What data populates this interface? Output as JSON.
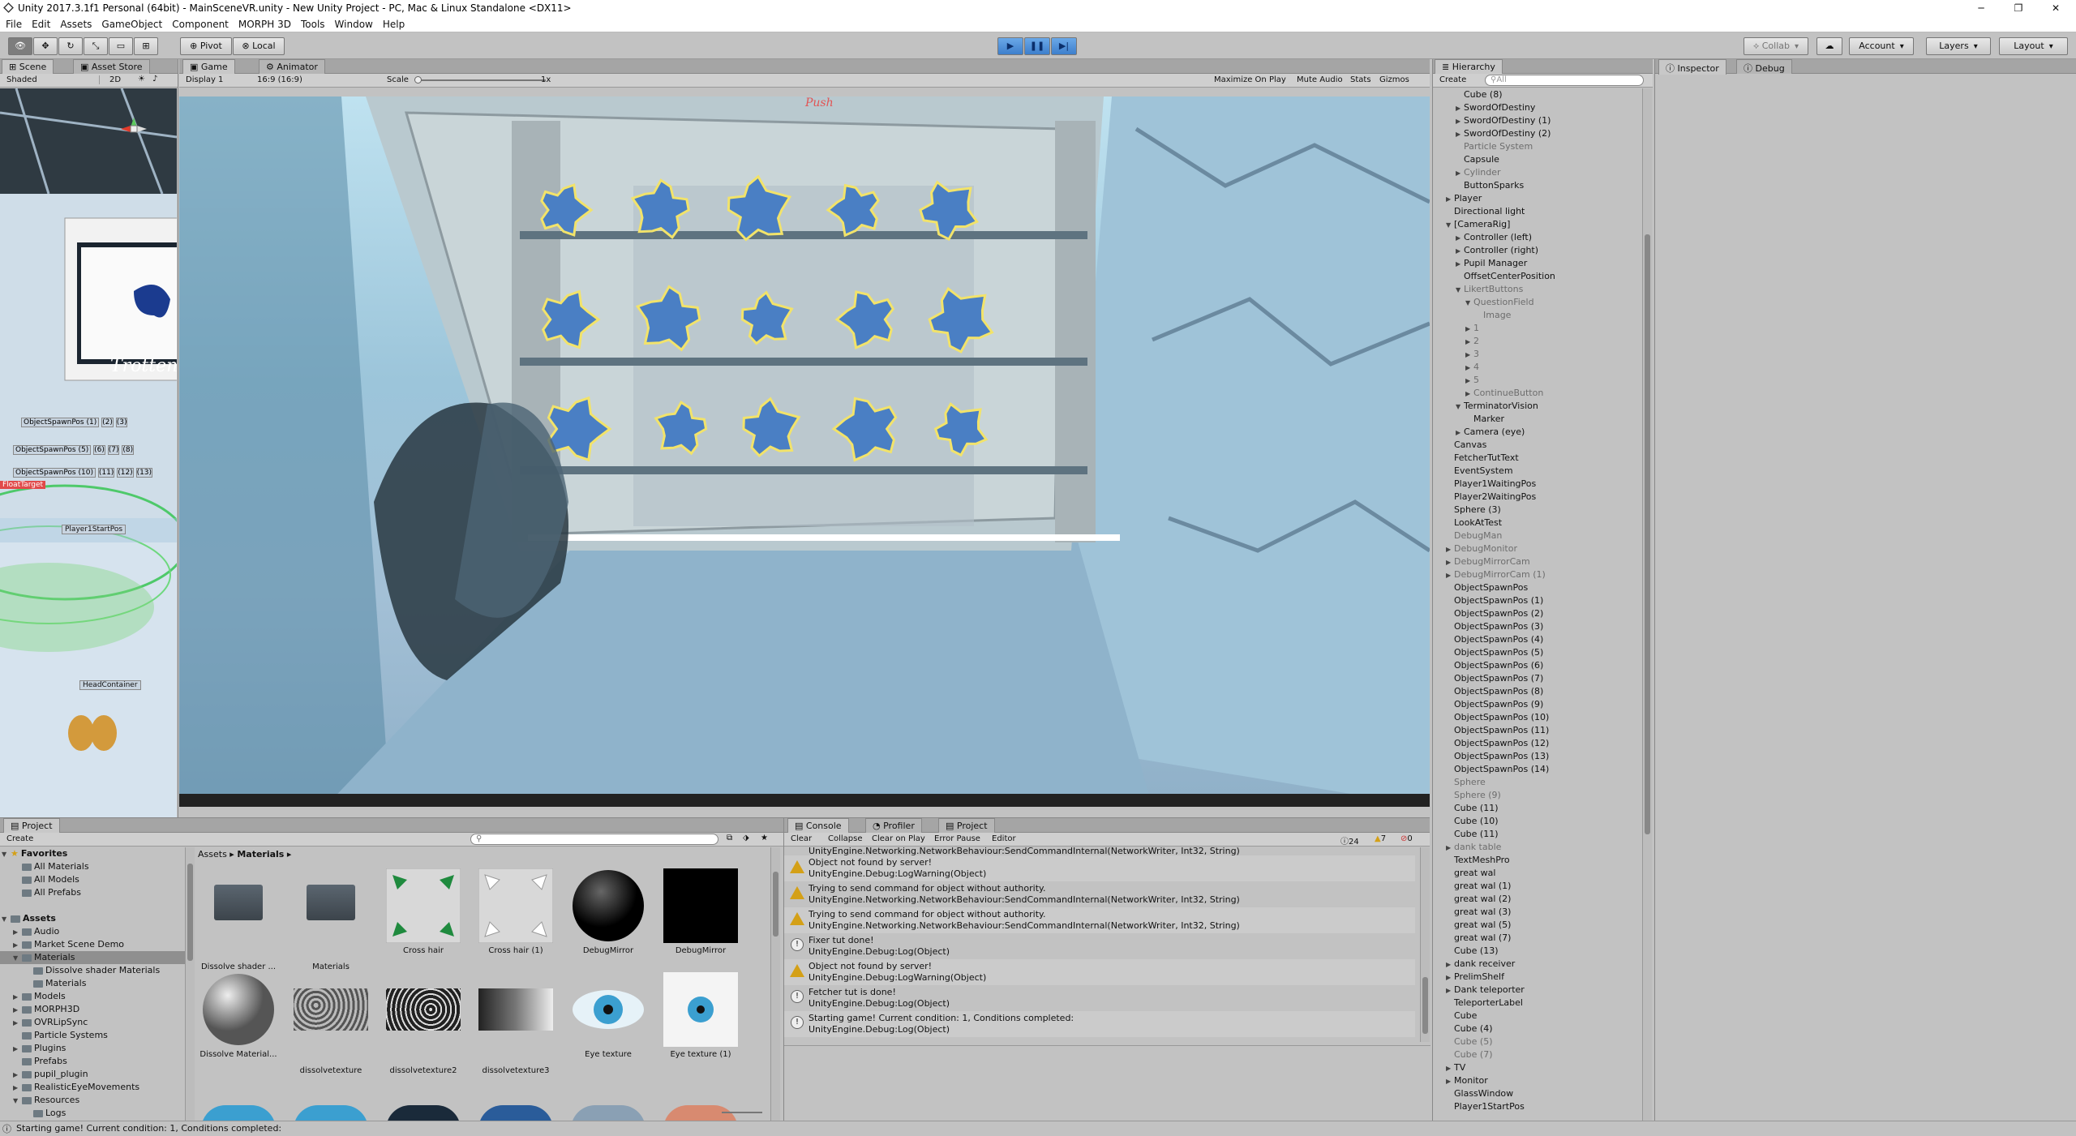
{
  "window": {
    "title": "Unity 2017.3.1f1 Personal (64bit) - MainSceneVR.unity - New Unity Project - PC, Mac & Linux Standalone <DX11>"
  },
  "menu": [
    "File",
    "Edit",
    "Assets",
    "GameObject",
    "Component",
    "MORPH 3D",
    "Tools",
    "Window",
    "Help"
  ],
  "toolbar": {
    "pivot": "Pivot",
    "local": "Local",
    "collab": "Collab",
    "account": "Account",
    "layers": "Layers",
    "layout": "Layout"
  },
  "scene": {
    "tabs": [
      "Scene",
      "Asset Store"
    ],
    "shading": "Shaded",
    "mode2d": "2D",
    "labels": [
      "ObjectSpawnPos (1)",
      "(2)",
      "(3)",
      "ObjectSpawnPos (5)",
      "(6)",
      "(7)",
      "(8)",
      "ObjectSpawnPos (10)",
      "(11)",
      "(12)",
      "(13)",
      "FloatTarget",
      "Player1StartPos",
      "HeadContainer"
    ],
    "monitor_text": "Trotten"
  },
  "game": {
    "tabs": [
      "Game",
      "Animator"
    ],
    "display": "Display 1",
    "aspect": "16:9 (16:9)",
    "scale_label": "Scale",
    "scale_value": "1x",
    "options": [
      "Maximize On Play",
      "Mute Audio",
      "Stats",
      "Gizmos"
    ],
    "annotation": "Push"
  },
  "hierarchy": {
    "tab": "Hierarchy",
    "create": "Create",
    "search": "All",
    "items": [
      {
        "label": "Cube (8)",
        "indent": 2,
        "arrow": "",
        "dim": false
      },
      {
        "label": "SwordOfDestiny",
        "indent": 2,
        "arrow": "r",
        "dim": false
      },
      {
        "label": "SwordOfDestiny (1)",
        "indent": 2,
        "arrow": "r",
        "dim": false
      },
      {
        "label": "SwordOfDestiny (2)",
        "indent": 2,
        "arrow": "r",
        "dim": false
      },
      {
        "label": "Particle System",
        "indent": 2,
        "arrow": "",
        "dim": true
      },
      {
        "label": "Capsule",
        "indent": 2,
        "arrow": "",
        "dim": false
      },
      {
        "label": "Cylinder",
        "indent": 2,
        "arrow": "r",
        "dim": true
      },
      {
        "label": "ButtonSparks",
        "indent": 2,
        "arrow": "",
        "dim": false
      },
      {
        "label": "Player",
        "indent": 1,
        "arrow": "r",
        "dim": false
      },
      {
        "label": "Directional light",
        "indent": 1,
        "arrow": "",
        "dim": false
      },
      {
        "label": "[CameraRig]",
        "indent": 1,
        "arrow": "d",
        "dim": false
      },
      {
        "label": "Controller (left)",
        "indent": 2,
        "arrow": "r",
        "dim": false
      },
      {
        "label": "Controller (right)",
        "indent": 2,
        "arrow": "r",
        "dim": false
      },
      {
        "label": "Pupil Manager",
        "indent": 2,
        "arrow": "r",
        "dim": false
      },
      {
        "label": "OffsetCenterPosition",
        "indent": 2,
        "arrow": "",
        "dim": false
      },
      {
        "label": "LikertButtons",
        "indent": 2,
        "arrow": "d",
        "dim": true
      },
      {
        "label": "QuestionField",
        "indent": 3,
        "arrow": "d",
        "dim": true
      },
      {
        "label": "Image",
        "indent": 4,
        "arrow": "",
        "dim": true
      },
      {
        "label": "1",
        "indent": 3,
        "arrow": "r",
        "dim": true
      },
      {
        "label": "2",
        "indent": 3,
        "arrow": "r",
        "dim": true
      },
      {
        "label": "3",
        "indent": 3,
        "arrow": "r",
        "dim": true
      },
      {
        "label": "4",
        "indent": 3,
        "arrow": "r",
        "dim": true
      },
      {
        "label": "5",
        "indent": 3,
        "arrow": "r",
        "dim": true
      },
      {
        "label": "ContinueButton",
        "indent": 3,
        "arrow": "r",
        "dim": true
      },
      {
        "label": "TerminatorVision",
        "indent": 2,
        "arrow": "d",
        "dim": false
      },
      {
        "label": "Marker",
        "indent": 3,
        "arrow": "",
        "dim": false
      },
      {
        "label": "Camera (eye)",
        "indent": 2,
        "arrow": "r",
        "dim": false
      },
      {
        "label": "Canvas",
        "indent": 1,
        "arrow": "",
        "dim": false
      },
      {
        "label": "FetcherTutText",
        "indent": 1,
        "arrow": "",
        "dim": false
      },
      {
        "label": "EventSystem",
        "indent": 1,
        "arrow": "",
        "dim": false
      },
      {
        "label": "Player1WaitingPos",
        "indent": 1,
        "arrow": "",
        "dim": false
      },
      {
        "label": "Player2WaitingPos",
        "indent": 1,
        "arrow": "",
        "dim": false
      },
      {
        "label": "Sphere (3)",
        "indent": 1,
        "arrow": "",
        "dim": false
      },
      {
        "label": "LookAtTest",
        "indent": 1,
        "arrow": "",
        "dim": false
      },
      {
        "label": "DebugMan",
        "indent": 1,
        "arrow": "",
        "dim": true
      },
      {
        "label": "DebugMonitor",
        "indent": 1,
        "arrow": "r",
        "dim": true
      },
      {
        "label": "DebugMirrorCam",
        "indent": 1,
        "arrow": "r",
        "dim": true
      },
      {
        "label": "DebugMirrorCam (1)",
        "indent": 1,
        "arrow": "r",
        "dim": true
      },
      {
        "label": "ObjectSpawnPos",
        "indent": 1,
        "arrow": "",
        "dim": false
      },
      {
        "label": "ObjectSpawnPos (1)",
        "indent": 1,
        "arrow": "",
        "dim": false
      },
      {
        "label": "ObjectSpawnPos (2)",
        "indent": 1,
        "arrow": "",
        "dim": false
      },
      {
        "label": "ObjectSpawnPos (3)",
        "indent": 1,
        "arrow": "",
        "dim": false
      },
      {
        "label": "ObjectSpawnPos (4)",
        "indent": 1,
        "arrow": "",
        "dim": false
      },
      {
        "label": "ObjectSpawnPos (5)",
        "indent": 1,
        "arrow": "",
        "dim": false
      },
      {
        "label": "ObjectSpawnPos (6)",
        "indent": 1,
        "arrow": "",
        "dim": false
      },
      {
        "label": "ObjectSpawnPos (7)",
        "indent": 1,
        "arrow": "",
        "dim": false
      },
      {
        "label": "ObjectSpawnPos (8)",
        "indent": 1,
        "arrow": "",
        "dim": false
      },
      {
        "label": "ObjectSpawnPos (9)",
        "indent": 1,
        "arrow": "",
        "dim": false
      },
      {
        "label": "ObjectSpawnPos (10)",
        "indent": 1,
        "arrow": "",
        "dim": false
      },
      {
        "label": "ObjectSpawnPos (11)",
        "indent": 1,
        "arrow": "",
        "dim": false
      },
      {
        "label": "ObjectSpawnPos (12)",
        "indent": 1,
        "arrow": "",
        "dim": false
      },
      {
        "label": "ObjectSpawnPos (13)",
        "indent": 1,
        "arrow": "",
        "dim": false
      },
      {
        "label": "ObjectSpawnPos (14)",
        "indent": 1,
        "arrow": "",
        "dim": false
      },
      {
        "label": "Sphere",
        "indent": 1,
        "arrow": "",
        "dim": true
      },
      {
        "label": "Sphere (9)",
        "indent": 1,
        "arrow": "",
        "dim": true
      },
      {
        "label": "Cube (11)",
        "indent": 1,
        "arrow": "",
        "dim": false
      },
      {
        "label": "Cube (10)",
        "indent": 1,
        "arrow": "",
        "dim": false
      },
      {
        "label": "Cube (11)",
        "indent": 1,
        "arrow": "",
        "dim": false
      },
      {
        "label": "dank table",
        "indent": 1,
        "arrow": "r",
        "dim": true
      },
      {
        "label": "TextMeshPro",
        "indent": 1,
        "arrow": "",
        "dim": false
      },
      {
        "label": "great wal",
        "indent": 1,
        "arrow": "",
        "dim": false
      },
      {
        "label": "great wal (1)",
        "indent": 1,
        "arrow": "",
        "dim": false
      },
      {
        "label": "great wal (2)",
        "indent": 1,
        "arrow": "",
        "dim": false
      },
      {
        "label": "great wal (3)",
        "indent": 1,
        "arrow": "",
        "dim": false
      },
      {
        "label": "great wal (5)",
        "indent": 1,
        "arrow": "",
        "dim": false
      },
      {
        "label": "great wal (7)",
        "indent": 1,
        "arrow": "",
        "dim": false
      },
      {
        "label": "Cube (13)",
        "indent": 1,
        "arrow": "",
        "dim": false
      },
      {
        "label": "dank receiver",
        "indent": 1,
        "arrow": "r",
        "dim": false
      },
      {
        "label": "PrelimShelf",
        "indent": 1,
        "arrow": "r",
        "dim": false
      },
      {
        "label": "Dank teleporter",
        "indent": 1,
        "arrow": "r",
        "dim": false
      },
      {
        "label": "TeleporterLabel",
        "indent": 1,
        "arrow": "",
        "dim": false
      },
      {
        "label": "Cube",
        "indent": 1,
        "arrow": "",
        "dim": false
      },
      {
        "label": "Cube (4)",
        "indent": 1,
        "arrow": "",
        "dim": false
      },
      {
        "label": "Cube (5)",
        "indent": 1,
        "arrow": "",
        "dim": true
      },
      {
        "label": "Cube (7)",
        "indent": 1,
        "arrow": "",
        "dim": true
      },
      {
        "label": "TV",
        "indent": 1,
        "arrow": "r",
        "dim": false
      },
      {
        "label": "Monitor",
        "indent": 1,
        "arrow": "r",
        "dim": false
      },
      {
        "label": "GlassWindow",
        "indent": 1,
        "arrow": "",
        "dim": false
      },
      {
        "label": "Player1StartPos",
        "indent": 1,
        "arrow": "",
        "dim": false
      }
    ]
  },
  "inspector": {
    "tabs": [
      "Inspector",
      "Debug"
    ]
  },
  "project": {
    "tab": "Project",
    "create": "Create",
    "breadcrumb": [
      "Assets",
      "Materials"
    ],
    "tree": [
      {
        "label": "Favorites",
        "indent": 0,
        "bold": true,
        "arrow": "d"
      },
      {
        "label": "All Materials",
        "indent": 1,
        "bold": false,
        "arrow": ""
      },
      {
        "label": "All Models",
        "indent": 1,
        "bold": false,
        "arrow": ""
      },
      {
        "label": "All Prefabs",
        "indent": 1,
        "bold": false,
        "arrow": ""
      },
      {
        "label": "",
        "indent": 0,
        "bold": false,
        "arrow": ""
      },
      {
        "label": "Assets",
        "indent": 0,
        "bold": true,
        "arrow": "d"
      },
      {
        "label": "Audio",
        "indent": 1,
        "bold": false,
        "arrow": "r"
      },
      {
        "label": "Market Scene Demo",
        "indent": 1,
        "bold": false,
        "arrow": "r"
      },
      {
        "label": "Materials",
        "indent": 1,
        "bold": false,
        "arrow": "d",
        "sel": true
      },
      {
        "label": "Dissolve shader Materials",
        "indent": 2,
        "bold": false,
        "arrow": ""
      },
      {
        "label": "Materials",
        "indent": 2,
        "bold": false,
        "arrow": ""
      },
      {
        "label": "Models",
        "indent": 1,
        "bold": false,
        "arrow": "r"
      },
      {
        "label": "MORPH3D",
        "indent": 1,
        "bold": false,
        "arrow": "r"
      },
      {
        "label": "OVRLipSync",
        "indent": 1,
        "bold": false,
        "arrow": "r"
      },
      {
        "label": "Particle Systems",
        "indent": 1,
        "bold": false,
        "arrow": ""
      },
      {
        "label": "Plugins",
        "indent": 1,
        "bold": false,
        "arrow": "r"
      },
      {
        "label": "Prefabs",
        "indent": 1,
        "bold": false,
        "arrow": ""
      },
      {
        "label": "pupil_plugin",
        "indent": 1,
        "bold": false,
        "arrow": "r"
      },
      {
        "label": "RealisticEyeMovements",
        "indent": 1,
        "bold": false,
        "arrow": "r"
      },
      {
        "label": "Resources",
        "indent": 1,
        "bold": false,
        "arrow": "d"
      },
      {
        "label": "Logs",
        "indent": 2,
        "bold": false,
        "arrow": ""
      }
    ],
    "assets": [
      {
        "label": "Dissolve shader ...",
        "kind": "folder"
      },
      {
        "label": "Materials",
        "kind": "folder"
      },
      {
        "label": "Cross hair",
        "kind": "cross-green"
      },
      {
        "label": "Cross hair (1)",
        "kind": "cross-white"
      },
      {
        "label": "DebugMirror",
        "kind": "black-sphere"
      },
      {
        "label": "DebugMirror",
        "kind": "black-square"
      },
      {
        "label": "Dissolve Material...",
        "kind": "grey-sphere"
      },
      {
        "label": "dissolvetexture",
        "kind": "noise-light"
      },
      {
        "label": "dissolvetexture2",
        "kind": "noise-dark"
      },
      {
        "label": "dissolvetexture3",
        "kind": "gradient"
      },
      {
        "label": "Eye texture",
        "kind": "eye"
      },
      {
        "label": "Eye texture (1)",
        "kind": "eye-white"
      }
    ]
  },
  "console": {
    "tabs": [
      "Console",
      "Profiler",
      "Project"
    ],
    "buttons": [
      "Clear",
      "Collapse",
      "Clear on Play",
      "Error Pause",
      "Editor"
    ],
    "counts": {
      "info": "24",
      "warn": "7",
      "error": "0"
    },
    "partial_top": "UnityEngine.Networking.NetworkBehaviour:SendCommandInternal(NetworkWriter, Int32, String)",
    "rows": [
      {
        "type": "warn",
        "line1": "Object not found by server!",
        "line2": "UnityEngine.Debug:LogWarning(Object)"
      },
      {
        "type": "warn",
        "line1": "Trying to send command for object without authority.",
        "line2": "UnityEngine.Networking.NetworkBehaviour:SendCommandInternal(NetworkWriter, Int32, String)"
      },
      {
        "type": "warn",
        "line1": "Trying to send command for object without authority.",
        "line2": "UnityEngine.Networking.NetworkBehaviour:SendCommandInternal(NetworkWriter, Int32, String)"
      },
      {
        "type": "info",
        "line1": "Fixer tut done!",
        "line2": "UnityEngine.Debug:Log(Object)"
      },
      {
        "type": "warn",
        "line1": "Object not found by server!",
        "line2": "UnityEngine.Debug:LogWarning(Object)"
      },
      {
        "type": "info",
        "line1": "Fetcher tut is done!",
        "line2": "UnityEngine.Debug:Log(Object)"
      },
      {
        "type": "info",
        "line1": "Starting game! Current condition: 1, Conditions completed:",
        "line2": "UnityEngine.Debug:Log(Object)"
      }
    ]
  },
  "status": {
    "text": "Starting game! Current condition: 1, Conditions completed:"
  },
  "colors": {
    "play_active": "#4a90d9",
    "bg": "#c2c2c2"
  }
}
